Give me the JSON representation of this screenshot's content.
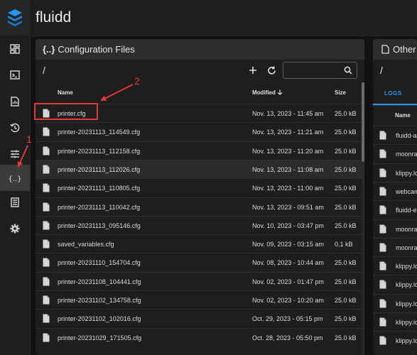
{
  "app": {
    "title": "fluidd"
  },
  "sidebar": {
    "items": [
      {
        "name": "dashboard"
      },
      {
        "name": "console"
      },
      {
        "name": "jobs"
      },
      {
        "name": "history"
      },
      {
        "name": "tune"
      },
      {
        "name": "configuration",
        "active": true
      },
      {
        "name": "system"
      },
      {
        "name": "settings"
      }
    ]
  },
  "config_panel": {
    "title": "Configuration Files",
    "path": "/",
    "search": {
      "value": "",
      "placeholder": ""
    },
    "columns": {
      "name": "Name",
      "modified": "Modified",
      "size": "Size"
    },
    "files": [
      {
        "name": "printer.cfg",
        "modified": "Nov. 13, 2023 - 11:45 am",
        "size": "25.0 kB"
      },
      {
        "name": "printer-20231113_114549.cfg",
        "modified": "Nov. 13, 2023 - 11:21 am",
        "size": "25.0 kB"
      },
      {
        "name": "printer-20231113_112158.cfg",
        "modified": "Nov. 13, 2023 - 11:20 am",
        "size": "25.0 kB"
      },
      {
        "name": "printer-20231113_112026.cfg",
        "modified": "Nov. 13, 2023 - 11:08 am",
        "size": "25.0 kB"
      },
      {
        "name": "printer-20231113_110805.cfg",
        "modified": "Nov. 13, 2023 - 11:00 am",
        "size": "25.0 kB"
      },
      {
        "name": "printer-20231113_110042.cfg",
        "modified": "Nov. 13, 2023 - 09:51 am",
        "size": "25.0 kB"
      },
      {
        "name": "printer-20231113_095146.cfg",
        "modified": "Nov. 10, 2023 - 03:47 pm",
        "size": "25.0 kB"
      },
      {
        "name": "saved_variables.cfg",
        "modified": "Nov. 09, 2023 - 03:15 am",
        "size": "0.1 kB"
      },
      {
        "name": "printer-20231110_154704.cfg",
        "modified": "Nov. 08, 2023 - 10:44 am",
        "size": "25.0 kB"
      },
      {
        "name": "printer-20231108_104441.cfg",
        "modified": "Nov. 02, 2023 - 01:47 pm",
        "size": "25.0 kB"
      },
      {
        "name": "printer-20231102_134758.cfg",
        "modified": "Nov. 02, 2023 - 10:20 am",
        "size": "25.0 kB"
      },
      {
        "name": "printer-20231102_102016.cfg",
        "modified": "Oct. 29, 2023 - 05:15 pm",
        "size": "25.0 kB"
      },
      {
        "name": "printer-20231029_171505.cfg",
        "modified": "Oct. 28, 2023 - 05:50 pm",
        "size": "25.0 kB"
      }
    ]
  },
  "other_panel": {
    "title": "Other",
    "path": "/",
    "tab": "LOGS",
    "column": "Name",
    "files": [
      "fluidd-a",
      "moonra",
      "klippy.lo",
      "webcam",
      "fluidd-e",
      "moonra",
      "moonra",
      "klippy.lo",
      "klippy.lo",
      "klippy.lo",
      "klippy.lo",
      "klippy.lo"
    ]
  },
  "annotations": {
    "label_1": "1",
    "label_2": "2",
    "color": "#e53935"
  },
  "colors": {
    "accent": "#2196f3",
    "background": "#121212",
    "panel": "#1e1e1e",
    "header": "#2d2d2d"
  }
}
